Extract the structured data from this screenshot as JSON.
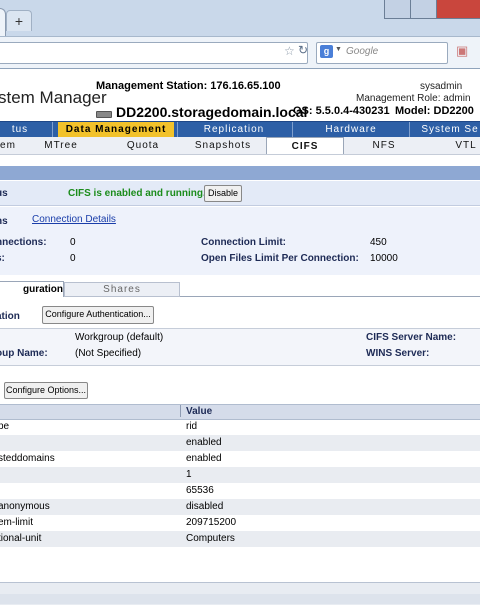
{
  "browser": {
    "new_tab_label": "+",
    "search_placeholder": "Google",
    "search_engine_badge": "g"
  },
  "header": {
    "title": "stem Manager",
    "management_station": "Management Station: 176.16.65.100",
    "system_name": "DD2200.storagedomain.local",
    "os_version": "OS: 5.5.0.4-430231",
    "model": "Model: DD2200",
    "user": "sysadmin",
    "role": "Management Role: admin"
  },
  "main_nav": [
    "tus",
    "Data Management",
    "Replication",
    "Hardware",
    "System Se"
  ],
  "sub_nav": [
    "em",
    "MTree",
    "Quota",
    "Snapshots",
    "CIFS",
    "NFS",
    "VTL"
  ],
  "status": {
    "label": "us",
    "text": "CIFS is enabled and running.",
    "disable_label": "Disable"
  },
  "connections": {
    "heading": "ns",
    "link": "Connection Details",
    "rows": [
      {
        "label": "nnections:",
        "value": "0",
        "label2": "Connection Limit:",
        "value2": "450"
      },
      {
        "label": "s:",
        "value": "0",
        "label2": "Open Files Limit Per Connection:",
        "value2": "10000"
      }
    ]
  },
  "tabs": {
    "configuration": "guration",
    "shares": "Shares"
  },
  "authentication": {
    "label": "ation",
    "button": "Configure Authentication..."
  },
  "workgroup": {
    "row1_value": "Workgroup (default)",
    "row1_label2": "CIFS Server Name:",
    "row2_label": "oup Name:",
    "row2_value": "(Not Specified)",
    "row2_label2": "WINS Server:"
  },
  "options": {
    "button": "Configure Options...",
    "value_header": "Value",
    "rows": [
      {
        "name": "pe",
        "value": "rid"
      },
      {
        "name": "",
        "value": "enabled"
      },
      {
        "name": "steddomains",
        "value": "enabled"
      },
      {
        "name": "",
        "value": "1"
      },
      {
        "name": "",
        "value": "65536"
      },
      {
        "name": "anonymous",
        "value": "disabled"
      },
      {
        "name": "em-limit",
        "value": "209715200"
      },
      {
        "name": "tional-unit",
        "value": "Computers"
      }
    ]
  }
}
